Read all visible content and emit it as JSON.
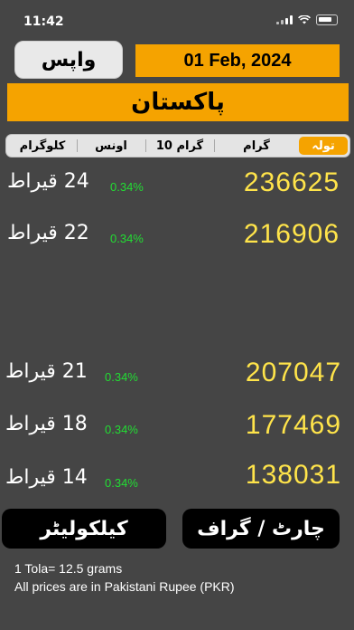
{
  "status_bar": {
    "time": "11:42"
  },
  "header": {
    "back_label": "واپس",
    "date": "01 Feb, 2024",
    "country": "پاکستان"
  },
  "unit_tabs": [
    {
      "label": "کلوگرام",
      "active": false
    },
    {
      "label": "اونس",
      "active": false
    },
    {
      "label": "10 گرام",
      "active": false
    },
    {
      "label": "گرام",
      "active": false
    },
    {
      "label": "تولہ",
      "active": true
    }
  ],
  "prices": [
    {
      "karat": "24 قیراط",
      "change": "0.34%",
      "price": "236625"
    },
    {
      "karat": "22 قیراط",
      "change": "0.34%",
      "price": "216906"
    },
    {
      "karat": "21 قیراط",
      "change": "0.34%",
      "price": "207047"
    },
    {
      "karat": "18 قیراط",
      "change": "0.34%",
      "price": "177469"
    },
    {
      "karat": "14 قیراط",
      "change": "0.34%",
      "price": "138031"
    }
  ],
  "buttons": {
    "calculator": "کیلکولیٹر",
    "chart": "چارٹ / گراف"
  },
  "notes": {
    "tola": "1 Tola= 12.5 grams",
    "currency": "All prices are in Pakistani Rupee (PKR)"
  },
  "colors": {
    "background": "#454545",
    "accent": "#f5a300",
    "price": "#ffe44a",
    "change_up": "#22dd33"
  }
}
